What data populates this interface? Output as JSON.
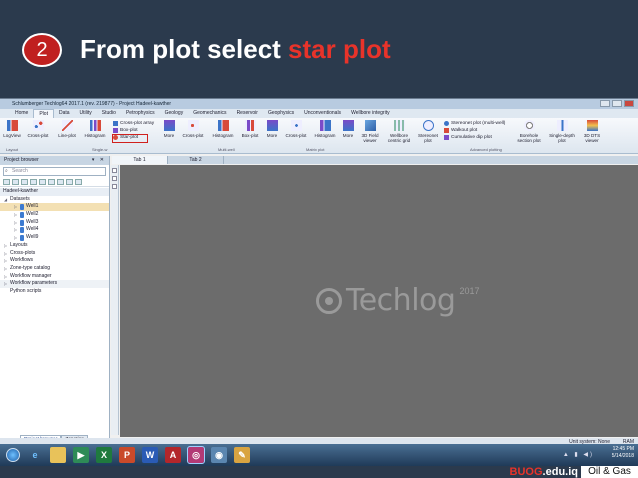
{
  "slide": {
    "step": "2",
    "title_plain": "From plot select ",
    "title_highlight": "star plot"
  },
  "app": {
    "title": "Schlumberger Techlog64 2017.1 (rev. 219877) - Project Hadeel-kawther",
    "ribbon_tabs": [
      "Home",
      "Plot",
      "Data",
      "Utility",
      "Studio",
      "Petrophysics",
      "Geology",
      "Geomechanics",
      "Reservoir",
      "Geophysics",
      "Unconventionals",
      "Wellbore integrity"
    ],
    "active_tab": "Plot",
    "ribbon": {
      "logview": "LogView",
      "crossplot": "Cross-plot",
      "lineplot": "Line-plot",
      "histogram": "Histogram",
      "crossplot_array": "Cross-plot array",
      "boxplot_small": "Box-plot",
      "starplot": "Star-plot",
      "more1": "More",
      "crossplot2": "Cross-plot",
      "histogram2": "Histogram",
      "boxplot2": "Box-plot",
      "more2": "More",
      "crossplot3": "Cross-plot",
      "histogram3": "Histogram",
      "more3": "More",
      "field3d": "3D Field viewer",
      "wellbore_grid": "Wellbore centric grid",
      "stereonet": "Stereonet plot",
      "stereonet_multi": "Stereonet plot (multi-well)",
      "walkout": "Walkout plot",
      "cumulative_dip": "Cumulative dip plot",
      "borehole_section": "Borehole section plot",
      "single_depth": "Single-depth plot",
      "dts_viewer": "3D DTS viewer",
      "group_layout": "Layout",
      "group_single": "Single-w",
      "group_multi": "Multi-well",
      "group_matrix": "Matrix plot",
      "group_advanced": "Advanced plotting"
    },
    "doc_tabs": [
      "Tab 1",
      "Tab 2"
    ],
    "browser": {
      "title": "Project browser",
      "search_placeholder": "Search",
      "project": "Hadeel-kawther",
      "datasets": "Datasets",
      "wells": [
        "Well1",
        "Well2",
        "Well3",
        "Well4",
        "Well9"
      ],
      "items": [
        "Layouts",
        "Cross-plots",
        "Workflows",
        "Zone-type catalog",
        "Workflow manager",
        "Workflow parameters",
        "Python scripts"
      ],
      "bottom_tabs": [
        "Project browser",
        "Zonation"
      ]
    },
    "logo": {
      "text": "Techlog",
      "year": "2017"
    },
    "status": {
      "unit_system": "Unit system: None",
      "ram": "RAM"
    }
  },
  "taskbar": {
    "time": "12:45 PM",
    "date": "5/14/2018"
  },
  "footer": {
    "brand_highlight": "BUOG",
    "brand_rest": ".edu.iq",
    "tag": "Oil & Gas"
  }
}
